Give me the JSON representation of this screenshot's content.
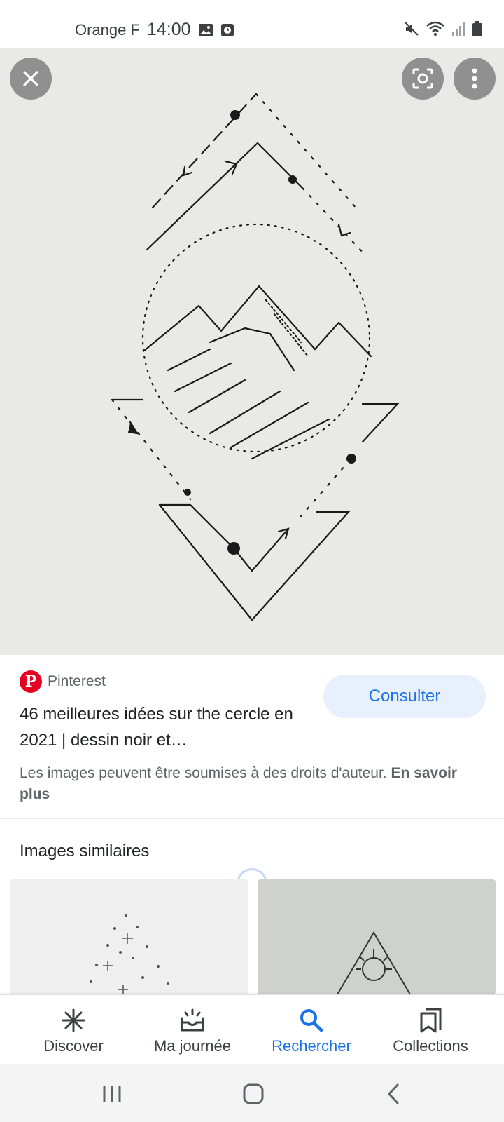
{
  "status_bar": {
    "carrier": "Orange F",
    "time": "14:00",
    "left_icons": [
      "gallery-icon",
      "alarm-icon"
    ],
    "right_icons": [
      "mute-icon",
      "wifi-icon",
      "signal-icon",
      "battery-icon"
    ]
  },
  "viewer": {
    "close_icon": "close-icon",
    "lens_icon": "lens-icon",
    "more_icon": "more-vert-icon",
    "background": "#e9e9e7"
  },
  "result": {
    "source": "Pinterest",
    "source_logo": "P",
    "title": "46 meilleures idées sur the cercle en 2021 | dessin noir et…",
    "visit_label": "Consulter",
    "copyright_text": "Les images peuvent être soumises à des droits d'auteur.",
    "learn_more": "En savoir plus"
  },
  "similar": {
    "title": "Images similaires"
  },
  "bottom_nav": [
    {
      "label": "Discover",
      "icon": "asterisk-icon",
      "active": false
    },
    {
      "label": "Ma journée",
      "icon": "inbox-tray-icon",
      "active": false
    },
    {
      "label": "Rechercher",
      "icon": "search-icon",
      "active": true
    },
    {
      "label": "Collections",
      "icon": "bookmarks-icon",
      "active": false
    }
  ],
  "system_nav": [
    "recent-apps-icon",
    "home-icon",
    "back-icon"
  ],
  "colors": {
    "accent": "#1a73e8",
    "pinterest": "#e60023",
    "button_bg": "#e8f0fe"
  }
}
